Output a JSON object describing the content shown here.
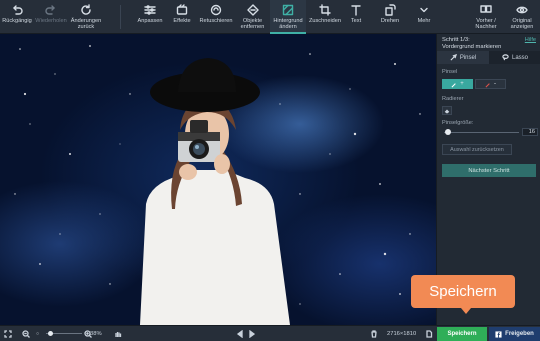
{
  "toolbar": {
    "undo": "Rückgängig",
    "redo": "Wiederholen",
    "revert": "Änderungen zurück",
    "adjust": "Anpassen",
    "effects": "Effekte",
    "retouch": "Retuschieren",
    "remove_objects": "Objekte entfernen",
    "change_background": "Hintergrund ändern",
    "crop": "Zuschneiden",
    "text": "Text",
    "rotate": "Drehen",
    "more": "Mehr",
    "before_after": "Vorher / Nachher",
    "show_original": "Original anzeigen"
  },
  "panel": {
    "step_title": "Schritt 1/3:\nVordergrund markieren",
    "help": "Hilfe",
    "tabs": [
      "Pinsel",
      "Lasso"
    ],
    "brush_label": "Pinsel",
    "eraser_label": "Radierer",
    "brush_size_label": "Pinselgröße:",
    "brush_size_value": "16",
    "brush_size_fraction": 0.03,
    "reset_selection": "Auswahl zurücksetzen",
    "next_step": "Nächster Schritt",
    "brush_plus": "+",
    "brush_minus": "-"
  },
  "bottombar": {
    "zoom_percent": "38%",
    "image_size": "2716×1810",
    "save": "Speichern",
    "share": "Freigeben"
  },
  "callout": {
    "text": "Speichern"
  },
  "colors": {
    "accent": "#39a89f",
    "save_green": "#2fae58",
    "callout_orange": "#f28a54",
    "share_blue": "#1f3d6e"
  }
}
